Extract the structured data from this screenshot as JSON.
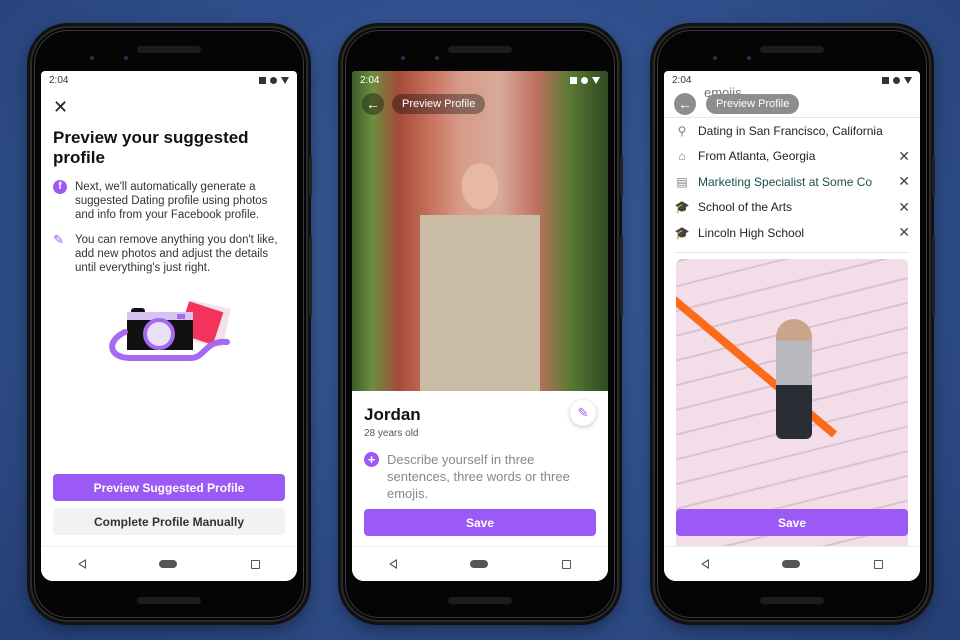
{
  "colors": {
    "accent": "#9b59f5",
    "background": "#2f4f8c"
  },
  "phones": [
    {
      "status_time": "2:04",
      "close_icon": "✕",
      "title": "Preview your suggested profile",
      "info": [
        {
          "icon": "facebook-icon",
          "glyph": "f",
          "text": "Next, we'll automatically generate a suggested Dating profile using photos and info from your Facebook profile."
        },
        {
          "icon": "pencil-icon",
          "glyph": "✎",
          "text": "You can remove anything you don't like, add new photos and adjust the details until everything's just right."
        }
      ],
      "primary_button": "Preview Suggested Profile",
      "secondary_button": "Complete Profile Manually"
    },
    {
      "status_time": "2:04",
      "back_glyph": "←",
      "header_pill": "Preview Profile",
      "name": "Jordan",
      "age": "28 years old",
      "edit_glyph": "✎",
      "plus_glyph": "+",
      "prompt": "Describe yourself in three sentences, three words or three emojis.",
      "save_button": "Save"
    },
    {
      "status_time": "2:04",
      "back_glyph": "←",
      "header_pill": "Preview Profile",
      "faded_text": "emojis.",
      "details": [
        {
          "icon": "location-pin-icon",
          "glyph": "⚲",
          "text": "Dating in San Francisco, California",
          "removable": false,
          "remove_glyph": ""
        },
        {
          "icon": "home-icon",
          "glyph": "⌂",
          "text": "From Atlanta, Georgia",
          "removable": true,
          "remove_glyph": "✕"
        },
        {
          "icon": "briefcase-icon",
          "glyph": "▤",
          "text": "Marketing Specialist at Some Co",
          "removable": true,
          "remove_glyph": "✕"
        },
        {
          "icon": "graduation-cap-icon",
          "glyph": "🎓",
          "text": "School of the Arts",
          "removable": true,
          "remove_glyph": "✕"
        },
        {
          "icon": "graduation-cap-icon",
          "glyph": "🎓",
          "text": "Lincoln High School",
          "removable": true,
          "remove_glyph": "✕"
        }
      ],
      "save_button": "Save"
    }
  ]
}
